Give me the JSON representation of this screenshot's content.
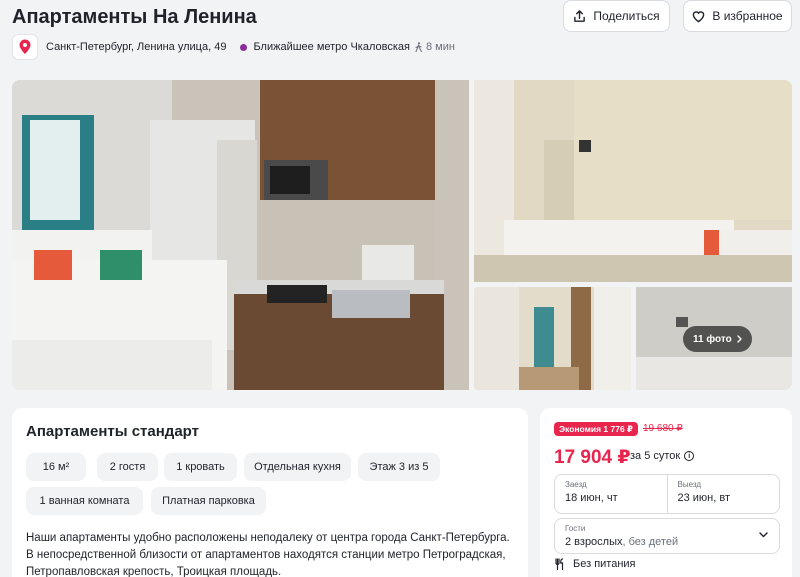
{
  "header": {
    "title": "Апартаменты На Ленина",
    "share_label": "Поделиться",
    "favorite_label": "В избранное"
  },
  "location": {
    "address": "Санкт-Петербург, Ленина улица, 49",
    "metro": "Ближайшее метро Чкаловская",
    "walk_time": "8 мин",
    "metro_color": "#8b2d9c"
  },
  "gallery": {
    "more_photos_label": "11 фото"
  },
  "room": {
    "title": "Апартаменты стандарт",
    "features": [
      "16 м²",
      "2 гостя",
      "1 кровать",
      "Отдельная кухня",
      "Этаж 3 из 5",
      "1 ванная комната",
      "Платная парковка"
    ],
    "description": "Наши апартаменты удобно расположены неподалеку от центра города Санкт-Петербурга. В непосредственной близости от апартаментов находятся станции метро Петроградская, Петропавловская крепость, Троицкая площадь."
  },
  "booking": {
    "economy_badge": "Экономия 1 776 ₽",
    "old_price": "19 680 ₽",
    "price": "17 904 ₽",
    "price_note": "за 5 суток",
    "checkin_label": "Заезд",
    "checkin_value": "18 июн, чт",
    "checkout_label": "Выезд",
    "checkout_value": "23 июн, вт",
    "guests_label": "Гости",
    "guests_value": "2 взрослых",
    "guests_extra": ", без детей",
    "meal": "Без питания",
    "accent_color": "#e8254d"
  }
}
